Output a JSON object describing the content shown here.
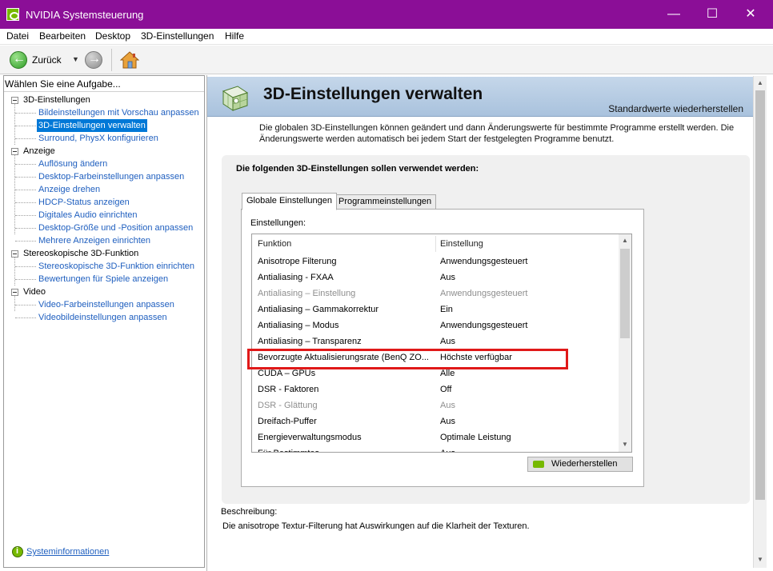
{
  "window": {
    "title": "NVIDIA Systemsteuerung",
    "controls": {
      "minimize": "—",
      "maximize": "☐",
      "close": "✕"
    },
    "titlebar_color": "#8b0e97"
  },
  "menu": [
    "Datei",
    "Bearbeiten",
    "Desktop",
    "3D-Einstellungen",
    "Hilfe"
  ],
  "toolbar": {
    "back_label": "Zurück",
    "dropdown_glyph": "▼"
  },
  "left_panel": {
    "header": "Wählen Sie eine Aufgabe...",
    "categories": [
      {
        "label": "3D-Einstellungen",
        "items": [
          "Bildeinstellungen mit Vorschau anpassen",
          "3D-Einstellungen verwalten",
          "Surround, PhysX konfigurieren"
        ]
      },
      {
        "label": "Anzeige",
        "items": [
          "Auflösung ändern",
          "Desktop-Farbeinstellungen anpassen",
          "Anzeige drehen",
          "HDCP-Status anzeigen",
          "Digitales Audio einrichten",
          "Desktop-Größe und -Position anpassen",
          "Mehrere Anzeigen einrichten"
        ]
      },
      {
        "label": "Stereoskopische 3D-Funktion",
        "items": [
          "Stereoskopische 3D-Funktion einrichten",
          "Bewertungen für Spiele anzeigen"
        ]
      },
      {
        "label": "Video",
        "items": [
          "Video-Farbeinstellungen anpassen",
          "Videobildeinstellungen anpassen"
        ]
      }
    ],
    "selected_item": "3D-Einstellungen verwalten",
    "footer_link": "Systeminformationen"
  },
  "main": {
    "title": "3D-Einstellungen verwalten",
    "restore_defaults": "Standardwerte wiederherstellen",
    "intro": "Die globalen 3D-Einstellungen können geändert und dann Änderungswerte für bestimmte Programme erstellt werden. Die Änderungswerte werden automatisch bei jedem Start der festgelegten Programme benutzt.",
    "section_heading": "Die folgenden 3D-Einstellungen sollen verwendet werden:",
    "tabs": [
      {
        "label": "Globale Einstellungen",
        "active": true
      },
      {
        "label": "Programmeinstellungen",
        "active": false
      }
    ],
    "settings_label": "Einstellungen:",
    "table": {
      "columns": [
        "Funktion",
        "Einstellung"
      ],
      "rows": [
        {
          "function": "Anisotrope Filterung",
          "setting": "Anwendungsgesteuert",
          "disabled": false
        },
        {
          "function": "Antialiasing - FXAA",
          "setting": "Aus",
          "disabled": false
        },
        {
          "function": "Antialiasing – Einstellung",
          "setting": "Anwendungsgesteuert",
          "disabled": true
        },
        {
          "function": "Antialiasing – Gammakorrektur",
          "setting": "Ein",
          "disabled": false
        },
        {
          "function": "Antialiasing – Modus",
          "setting": "Anwendungsgesteuert",
          "disabled": false
        },
        {
          "function": "Antialiasing – Transparenz",
          "setting": "Aus",
          "disabled": false
        },
        {
          "function": "Bevorzugte Aktualisierungsrate (BenQ ZO...",
          "setting": "Höchste verfügbar",
          "disabled": false
        },
        {
          "function": "CUDA – GPUs",
          "setting": "Alle",
          "disabled": false
        },
        {
          "function": "DSR - Faktoren",
          "setting": "Off",
          "disabled": false
        },
        {
          "function": "DSR - Glättung",
          "setting": "Aus",
          "disabled": true
        },
        {
          "function": "Dreifach-Puffer",
          "setting": "Aus",
          "disabled": false
        },
        {
          "function": "Energieverwaltungsmodus",
          "setting": "Optimale Leistung",
          "disabled": false
        },
        {
          "function": "Für Bestimmtes...",
          "setting": "Aus",
          "disabled": false
        }
      ],
      "highlighted_row_index": 6,
      "highlight_color": "#e01919"
    },
    "restore_button": "Wiederherstellen",
    "description_label": "Beschreibung:",
    "description": "Die anisotrope Textur-Filterung hat Auswirkungen auf die Klarheit der Texturen."
  }
}
